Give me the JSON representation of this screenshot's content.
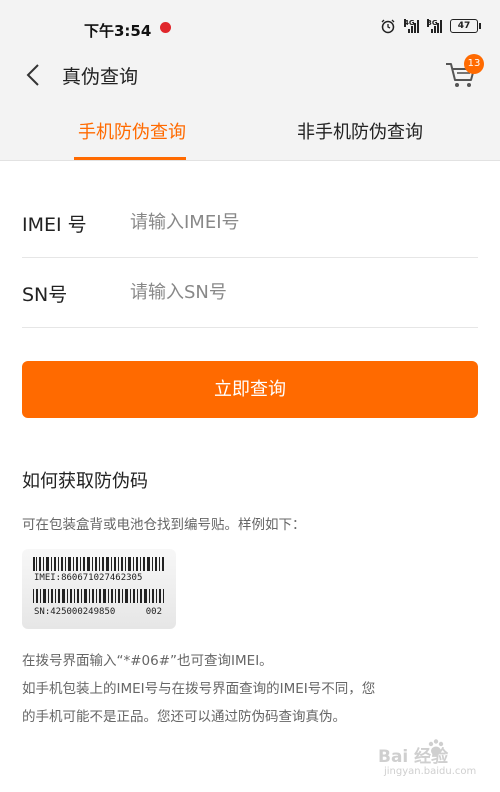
{
  "status_bar": {
    "time": "下午3:54",
    "network_1": "4G",
    "network_2": "3G",
    "battery": "47"
  },
  "header": {
    "title": "真伪查询",
    "cart_badge": "13"
  },
  "tabs": [
    {
      "label": "手机防伪查询",
      "active": true
    },
    {
      "label": "非手机防伪查询",
      "active": false
    }
  ],
  "form": {
    "imei": {
      "label": "IMEI 号",
      "placeholder": "请输入IMEI号",
      "value": ""
    },
    "sn": {
      "label": "SN号",
      "placeholder": "请输入SN号",
      "value": ""
    },
    "submit_label": "立即查询"
  },
  "help": {
    "title": "如何获取防伪码",
    "subtitle": "可在包装盒背或电池仓找到编号贴。样例如下：",
    "sample_label": {
      "imei_text": "IMEI:860671027462305",
      "sn_text": "SN:425000249850",
      "code": "002"
    },
    "note_1": "在拨号界面输入“*#06#”也可查询IMEI。",
    "note_2": "如手机包装上的IMEI号与在拨号界面查询的IMEI号不同，您",
    "note_3": "的手机可能不是正品。您还可以通过防伪码查询真伪。"
  },
  "watermark": {
    "brand": "Bai 经验",
    "url": "jingyan.baidu.com"
  },
  "colors": {
    "accent": "#ff6a00",
    "header_bg": "#f3f3f3"
  }
}
